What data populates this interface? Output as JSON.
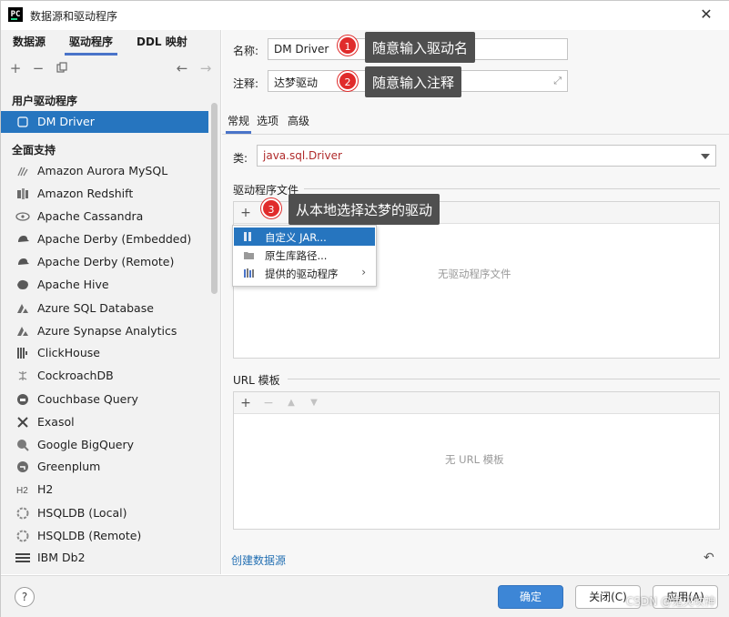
{
  "window": {
    "title": "数据源和驱动程序",
    "close_glyph": "✕"
  },
  "left": {
    "tabs": [
      {
        "label": "数据源"
      },
      {
        "label": "驱动程序"
      },
      {
        "label": "DDL 映射"
      }
    ],
    "toolbar": [
      "plus-icon",
      "minus-icon",
      "copy-icon",
      "arrow-left-icon",
      "arrow-right-icon"
    ],
    "user_drivers_heading": "用户驱动程序",
    "selected_driver": "DM Driver",
    "full_support_heading": "全面支持",
    "drivers": [
      {
        "label": "Amazon Aurora MySQL",
        "icon": "aurora-icon"
      },
      {
        "label": "Amazon Redshift",
        "icon": "redshift-icon"
      },
      {
        "label": "Apache Cassandra",
        "icon": "cassandra-icon"
      },
      {
        "label": "Apache Derby (Embedded)",
        "icon": "derby-icon"
      },
      {
        "label": "Apache Derby (Remote)",
        "icon": "derby-icon"
      },
      {
        "label": "Apache Hive",
        "icon": "hive-icon"
      },
      {
        "label": "Azure SQL Database",
        "icon": "azure-icon"
      },
      {
        "label": "Azure Synapse Analytics",
        "icon": "azure-icon"
      },
      {
        "label": "ClickHouse",
        "icon": "clickhouse-icon"
      },
      {
        "label": "CockroachDB",
        "icon": "cockroach-icon"
      },
      {
        "label": "Couchbase Query",
        "icon": "couchbase-icon"
      },
      {
        "label": "Exasol",
        "icon": "exasol-icon"
      },
      {
        "label": "Google BigQuery",
        "icon": "bigquery-icon"
      },
      {
        "label": "Greenplum",
        "icon": "greenplum-icon"
      },
      {
        "label": "H2",
        "icon": "h2-icon"
      },
      {
        "label": "HSQLDB (Local)",
        "icon": "hsqldb-icon"
      },
      {
        "label": "HSQLDB (Remote)",
        "icon": "hsqldb-icon"
      },
      {
        "label": "IBM Db2",
        "icon": "ibm-icon"
      }
    ]
  },
  "right": {
    "name_label": "名称:",
    "name_value": "DM Driver",
    "comment_label": "注释:",
    "comment_value": "达梦驱动",
    "subtabs": [
      {
        "label": "常规"
      },
      {
        "label": "选项"
      },
      {
        "label": "高级"
      }
    ],
    "class_label": "类:",
    "class_value": "java.sql.Driver",
    "driver_files_label": "驱动程序文件",
    "driver_files_empty": "无驱动程序文件",
    "popup": [
      {
        "label": "自定义 JAR..."
      },
      {
        "label": "原生库路径..."
      },
      {
        "label": "提供的驱动程序"
      }
    ],
    "url_templates_label": "URL 模板",
    "url_templates_empty": "无 URL 模板",
    "create_datasource_link": "创建数据源"
  },
  "footer": {
    "help": "?",
    "ok": "确定",
    "close": "关闭(C)",
    "apply": "应用(A)"
  },
  "annotations": [
    {
      "num": "1",
      "text": "随意输入驱动名"
    },
    {
      "num": "2",
      "text": "随意输入注释"
    },
    {
      "num": "3",
      "text": "从本地选择达梦的驱动"
    }
  ],
  "watermark": "CSDN @鬼灭吹神",
  "colors": {
    "selection": "#2675bf",
    "primary_button": "#3d86d6",
    "tab_indicator": "#4a74c9",
    "class_text": "#b02b2b",
    "badge": "#e02b2b",
    "note_bg": "#4f4f4f",
    "link": "#2470b3"
  }
}
